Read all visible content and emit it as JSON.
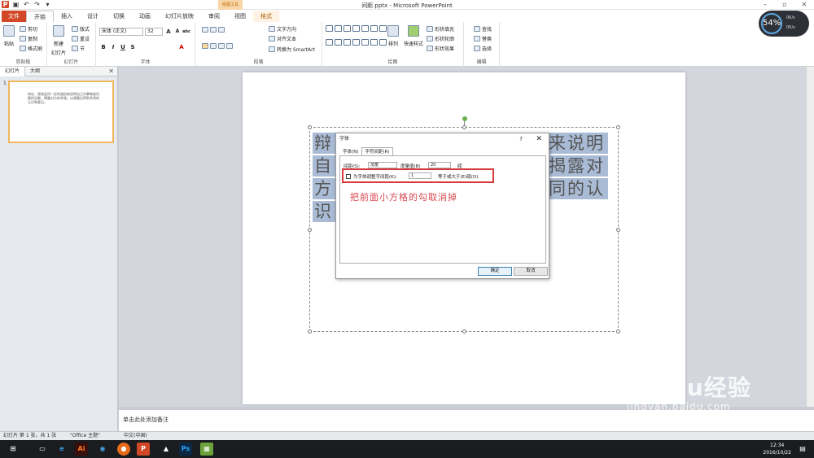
{
  "titlebar": {
    "title": "间距.pptx - Microsoft PowerPoint",
    "context_group": "绘图工具",
    "app_icon": "P",
    "qat_icons": [
      "save-icon",
      "undo-icon",
      "redo-icon",
      "customize-icon"
    ]
  },
  "ribbon_tabs": [
    "文件",
    "开始",
    "插入",
    "设计",
    "切换",
    "动画",
    "幻灯片放映",
    "审阅",
    "视图",
    "格式"
  ],
  "ribbon": {
    "clipboard": {
      "paste": "粘贴",
      "cut": "剪切",
      "copy": "复制",
      "format_painter": "格式刷",
      "label": "剪贴板"
    },
    "slides": {
      "new_slide": "新建",
      "new_slide2": "幻灯片",
      "layout": "版式",
      "reset": "重设",
      "section": "节",
      "label": "幻灯片"
    },
    "font": {
      "name": "宋体 (正文)",
      "size": "32",
      "grow": "A",
      "shrink": "A",
      "bold": "B",
      "italic": "I",
      "underline": "U",
      "strike": "S",
      "abc": "abc",
      "label": "字体"
    },
    "paragraph": {
      "text_direction": "文字方向",
      "align_text": "对齐文本",
      "smartart": "转换为 SmartArt",
      "label": "段落"
    },
    "drawing": {
      "arrange": "排列",
      "quick_styles": "快速样式",
      "shape_fill": "形状填充",
      "shape_outline": "形状轮廓",
      "shape_effects": "形状效果",
      "label": "绘图"
    },
    "editing": {
      "find": "查找",
      "replace": "替换",
      "select": "选择",
      "label": "编辑"
    }
  },
  "leftpanel": {
    "tab_slides": "幻灯片",
    "tab_outline": "大纲",
    "slide_number": "1",
    "thumb_text": "辩论、接收此用一定的道由来说明自己对事物或问题的见解，揭露对方的矛盾，以便最后得到共同的认识和意见。"
  },
  "slide": {
    "line1_left": "辩",
    "line1_right": "来说明",
    "line2_left": "自",
    "line2_right": "揭露对",
    "line3_left": "方",
    "line3_right": "同的认",
    "line4_left": "识"
  },
  "dialog": {
    "title": "字体",
    "help": "?",
    "close": "✕",
    "tabs": [
      "字体(N)",
      "字符间距(R)"
    ],
    "spacing_label": "间距(S):",
    "spacing_value": "加宽",
    "by_label": "度量值(B)",
    "by_value": "20",
    "unit": "磅",
    "kerning_label": "为字体调整字间距(K):",
    "kerning_value": "1",
    "kerning_suffix": "等于或大于(E)磅(O)",
    "ok": "确定",
    "cancel": "取消",
    "annotation": "把前面小方格的勾取消掉"
  },
  "notes": {
    "placeholder": "单击此处添加备注"
  },
  "statusbar": {
    "slide_info": "幻灯片 第 1 张，共 1 张",
    "theme": "\"Office 主题\"",
    "language": "中文(中国)"
  },
  "taskbar": {
    "time": "12:34",
    "date": "2016/10/22"
  },
  "meter": {
    "percent": "54%",
    "top": "0K/s",
    "bottom": "0K/s"
  },
  "watermark": {
    "main": "Baidu经验",
    "sub": "jingyan.baidu.com"
  },
  "colors": {
    "accent": "#d24726",
    "highlight": "#a9bbd5",
    "annotation_red": "#d83a3a"
  }
}
